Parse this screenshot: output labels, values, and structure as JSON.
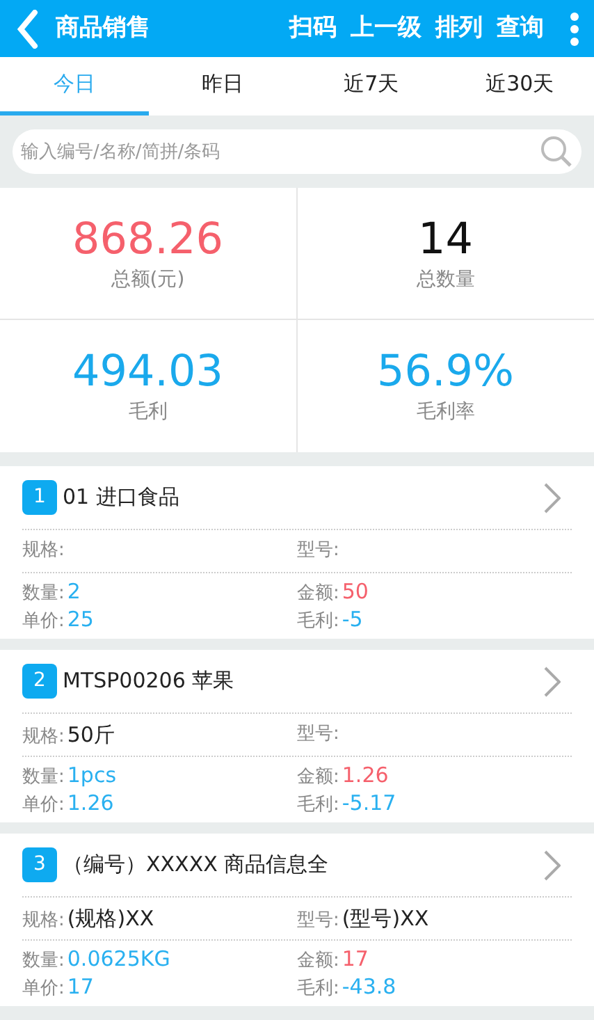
{
  "header": {
    "title": "商品销售",
    "actions": [
      "扫码",
      "上一级",
      "排列",
      "查询"
    ]
  },
  "tabs": [
    {
      "label": "今日",
      "selected": true
    },
    {
      "label": "昨日",
      "selected": false
    },
    {
      "label": "近7天",
      "selected": false
    },
    {
      "label": "近30天",
      "selected": false
    }
  ],
  "search": {
    "placeholder": "输入编号/名称/简拼/条码"
  },
  "stats": [
    {
      "value": "868.26",
      "label": "总额(元)",
      "color": "#f5606c"
    },
    {
      "value": "14",
      "label": "总数量",
      "color": "#111111"
    },
    {
      "value": "494.03",
      "label": "毛利",
      "color": "#1aa9ec"
    },
    {
      "value": "56.9%",
      "label": "毛利率",
      "color": "#1aa9ec"
    }
  ],
  "items": [
    {
      "index": "1",
      "title": "01 进口食品",
      "spec": {
        "label": "规格:"
      },
      "model": {
        "label": "型号:"
      },
      "qty": {
        "label": "数量:",
        "value": "2"
      },
      "amount": {
        "label": "金额:",
        "value": "50"
      },
      "price": {
        "label": "单价:",
        "value": "25"
      },
      "profit": {
        "label": "毛利:",
        "value": "-5"
      }
    },
    {
      "index": "2",
      "title": "MTSP00206 苹果",
      "spec": {
        "label": "规格:",
        "value": "50斤"
      },
      "model": {
        "label": "型号:"
      },
      "qty": {
        "label": "数量:",
        "value": "1pcs"
      },
      "amount": {
        "label": "金额:",
        "value": "1.26"
      },
      "price": {
        "label": "单价:",
        "value": "1.26"
      },
      "profit": {
        "label": "毛利:",
        "value": "-5.17"
      }
    },
    {
      "index": "3",
      "title": "（编号）XXXXX 商品信息全",
      "spec": {
        "label": "规格:",
        "value": "(规格)XX"
      },
      "model": {
        "label": "型号:",
        "value": "(型号)XX"
      },
      "qty": {
        "label": "数量:",
        "value": "0.0625KG"
      },
      "amount": {
        "label": "金额:",
        "value": "17"
      },
      "price": {
        "label": "单价:",
        "value": "17"
      },
      "profit": {
        "label": "毛利:",
        "value": "-43.8"
      }
    }
  ]
}
